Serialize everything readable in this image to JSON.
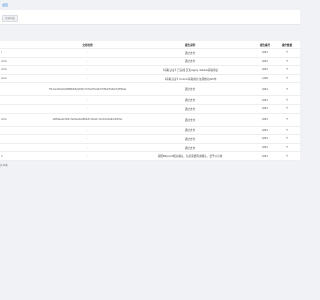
{
  "top_link": "返回",
  "filter_button": "查询列表",
  "table": {
    "headers": [
      "",
      "交易哈希",
      "报告说明",
      "报告编号",
      "操作数据"
    ],
    "rows": [
      {
        "c0": "r",
        "c1": "-",
        "c2": "通过支付",
        "c3": "0/01",
        "c4": "T"
      },
      {
        "c0": "com",
        "c1": "-",
        "c2": "通过支付",
        "c3": "0/01",
        "c4": "T"
      },
      {
        "c0": "com",
        "c1": "-",
        "c2": "【获取认证】已完成 买卖Apply details获取验证",
        "c3": "0/01",
        "c4": "T"
      },
      {
        "c0": "com",
        "c1": "-",
        "c2": "【获取认证】Unlock获取成功 处理成功API中",
        "c3": "1/00",
        "c4": "T"
      },
      {
        "c0": "",
        "c1": "7f14ce3d9ad0d08f8b0b82a580c707b42f7e4bcf708b07fe8e67d8f2b9a",
        "c2": "通过支付",
        "c3": "0/01",
        "c4": "T"
      },
      {
        "c0": "",
        "c1": "-",
        "c2": "通过支付",
        "c3": "0/01",
        "c4": "T"
      },
      {
        "c0": "",
        "c1": "-",
        "c2": "通过支付",
        "c3": "0/01",
        "c4": "T"
      },
      {
        "c0": "com",
        "c1": "a9f82ae4a7bf2c3e02a4d0e8f0b5c3d9a1c7e12cbdbe8c6d0f3a1",
        "c2": "通过支付",
        "c3": "0/01",
        "c4": "T"
      },
      {
        "c0": "",
        "c1": "-",
        "c2": "通过支付",
        "c3": "0/01",
        "c4": "T"
      },
      {
        "c0": "",
        "c1": "-",
        "c2": "通过支付",
        "c3": "0/01",
        "c4": "T"
      },
      {
        "c0": "",
        "c1": "-",
        "c2": "通过支付",
        "c3": "0/01",
        "c4": "T"
      },
      {
        "c0": "n",
        "c1": "-",
        "c2": "请把Bitpoint相关确认，信息需要再次确认，会予以可用",
        "c3": "0/01",
        "c4": "T"
      }
    ],
    "footer": "共12条"
  }
}
